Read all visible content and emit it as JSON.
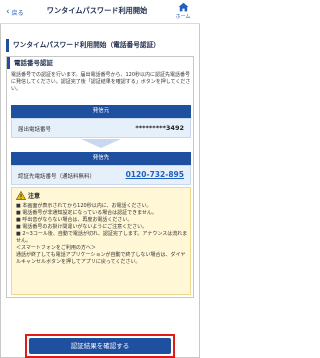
{
  "topbar": {
    "back_label": "戻る",
    "title": "ワンタイムパスワード利用開始",
    "home_label": "ホーム"
  },
  "page": {
    "heading": "ワンタイムパスワード利用開始（電話番号認証）"
  },
  "card": {
    "section_title": "電話番号認証",
    "description": "電話番号での認証を行います。届出電話番号から、120秒以内に認証先電話番号に発信してください。認証完了後「認証結果を確認する」ボタンを押してください。",
    "caller_box": {
      "header": "発信元",
      "label": "届出電話番号",
      "value": "*********3492"
    },
    "callee_box": {
      "header": "発信先",
      "label": "認証先電話番号（通話料無料）",
      "value": "0120-732-895"
    }
  },
  "notice": {
    "title": "注意",
    "items": [
      "■ 本画面が表示されてから120秒以内に、お電話ください。",
      "■ 電話番号が非通知設定になっている場合は認証できません。",
      "■ 呼出音がならない場合は、再度お電話ください。",
      "■ 電話番号のお掛け間違いがないようにご注意ください。",
      "■ 2~3コール後、自動で電話が切れ、認証完了します。アナウンスは流れません。",
      "＜スマートフォンをご利用の方へ＞",
      "通話が終了しても電話アプリケーションが自動で終了しない場合は、ダイヤルキャンセルボタンを押してアプリに戻ってください。"
    ]
  },
  "cta": {
    "label": "認証結果を確認する"
  }
}
